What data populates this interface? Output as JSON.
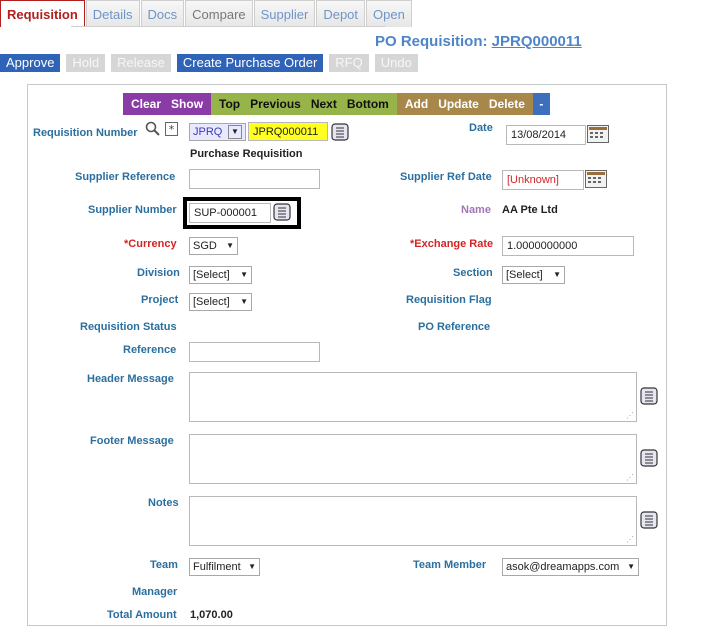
{
  "tabs": [
    "Requisition",
    "Details",
    "Docs",
    "Compare",
    "Supplier",
    "Depot",
    "Open"
  ],
  "title": {
    "prefix": "PO Requisition:",
    "number": "JPRQ000011"
  },
  "actions": {
    "approve": "Approve",
    "hold": "Hold",
    "release": "Release",
    "create_po": "Create Purchase Order",
    "rfq": "RFQ",
    "undo": "Undo"
  },
  "nav": {
    "clear": "Clear",
    "show": "Show",
    "top": "Top",
    "previous": "Previous",
    "next": "Next",
    "bottom": "Bottom",
    "add": "Add",
    "update": "Update",
    "delete": "Delete",
    "more": "-"
  },
  "form": {
    "requisition_number_label": "Requisition Number",
    "req_prefix": "JPRQ",
    "req_number": "JPRQ000011",
    "req_type": "Purchase Requisition",
    "date_label": "Date",
    "date_value": "13/08/2014",
    "supplier_reference_label": "Supplier Reference",
    "supplier_reference_value": "",
    "supplier_ref_date_label": "Supplier Ref Date",
    "supplier_ref_date_value": "[Unknown]",
    "supplier_number_label": "Supplier Number",
    "supplier_number_value": "SUP-000001",
    "name_label": "Name",
    "name_value": "AA Pte Ltd",
    "currency_label": "*Currency",
    "currency_value": "SGD",
    "exchange_rate_label": "*Exchange Rate",
    "exchange_rate_value": "1.0000000000",
    "division_label": "Division",
    "division_value": "[Select]",
    "section_label": "Section",
    "section_value": "[Select]",
    "project_label": "Project",
    "project_value": "[Select]",
    "requisition_flag_label": "Requisition Flag",
    "requisition_status_label": "Requisition Status",
    "po_reference_label": "PO Reference",
    "reference_label": "Reference",
    "reference_value": "",
    "header_message_label": "Header Message",
    "footer_message_label": "Footer Message",
    "notes_label": "Notes",
    "team_label": "Team",
    "team_value": "Fulfilment",
    "team_member_label": "Team Member",
    "team_member_value": "asok@dreamapps.com",
    "manager_label": "Manager",
    "total_amount_label": "Total Amount",
    "total_amount_value": "1,070.00"
  },
  "colors": {
    "accent": "#2f63b8",
    "tab_active": "#b0201f",
    "label": "#2b6f9f",
    "required": "#d42424"
  }
}
